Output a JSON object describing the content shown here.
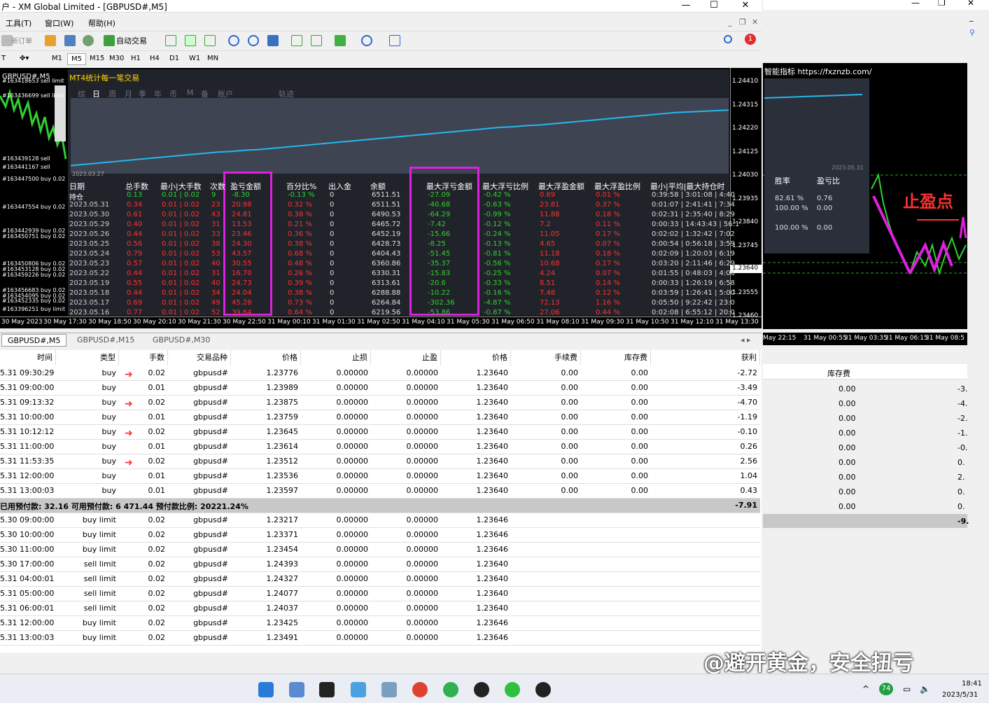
{
  "window": {
    "title": "户 - XM Global Limited - [GBPUSD#,M5]"
  },
  "menu": [
    "工具(T)",
    "窗口(W)",
    "帮助(H)"
  ],
  "toolbar": {
    "new_order": "新订单",
    "auto_trade": "自动交易",
    "notif_count": "1"
  },
  "timeframes": [
    "M1",
    "M5",
    "M15",
    "M30",
    "H1",
    "H4",
    "D1",
    "W1",
    "MN"
  ],
  "chart": {
    "title": "GBPUSD#,M5",
    "label_boxes": [
      "综",
      "日",
      "周",
      "月",
      "季",
      "年",
      "币",
      "M",
      "备",
      "账户",
      "轨迹"
    ],
    "panel_title": "MT4统计每一笔交易",
    "mini_start": "2023.03.27",
    "order_labels": [
      "#163418653 sell limit",
      "#163436699 sell limit",
      "#163439128 sell",
      "#163441167 sell",
      "#163447500 buy 0.02",
      "#163447554 buy 0.02",
      "#163442939 buy 0.02",
      "#163450751 buy 0.02",
      "#163450806 buy 0.02",
      "#163453128 buy 0.02",
      "#163459226 buy 0.02",
      "#163456683 buy 0.02",
      "#163454095 buy 0.02",
      "#163452335 buy 0.02",
      "#163396251 buy limit"
    ],
    "prices": [
      "1.24410",
      "1.24315",
      "1.24220",
      "1.24125",
      "1.24030",
      "1.23935",
      "1.23840",
      "1.23745",
      "1.23640",
      "1.23555",
      "1.23460"
    ],
    "times": [
      "30 May 2023",
      "30 May 17:30",
      "30 May 18:50",
      "30 May 20:10",
      "30 May 21:30",
      "30 May 22:50",
      "31 May 00:10",
      "31 May 01:30",
      "31 May 02:50",
      "31 May 04:10",
      "31 May 05:30",
      "31 May 06:50",
      "31 May 08:10",
      "31 May 09:30",
      "31 May 10:50",
      "31 May 12:10",
      "31 May 13:30"
    ],
    "equity_curve": [
      0.04,
      0.06,
      0.08,
      0.1,
      0.12,
      0.14,
      0.16,
      0.18,
      0.2,
      0.22,
      0.24,
      0.26,
      0.27,
      0.29,
      0.3,
      0.32,
      0.34,
      0.36,
      0.38,
      0.4,
      0.42,
      0.44,
      0.46,
      0.48,
      0.5,
      0.52,
      0.54,
      0.56,
      0.58,
      0.6,
      0.62,
      0.64,
      0.66,
      0.67,
      0.69,
      0.7,
      0.72,
      0.74,
      0.76,
      0.78,
      0.8,
      0.82,
      0.84,
      0.86,
      0.88,
      0.9,
      0.91,
      0.92,
      0.93,
      0.94
    ]
  },
  "stats": {
    "headers": [
      "日期",
      "总手数",
      "最小|大手数",
      "次数",
      "盈亏金额",
      "百分比%",
      "出入金",
      "余额",
      "最大浮亏金额",
      "最大浮亏比例",
      "最大浮盈金额",
      "最大浮盈比例",
      "最小|平均|最大持仓时"
    ],
    "rows": [
      [
        "持仓",
        "0.13",
        "0.01 | 0.02",
        "9",
        "-8.30",
        "-0.13 %",
        "0",
        "6511.51",
        "-27.09",
        "-0.42 %",
        "0.69",
        "0.01 %",
        "0:39:58 | 3:01:08 | 4:40"
      ],
      [
        "2023.05.31",
        "0.34",
        "0.01 | 0.02",
        "23",
        "20.98",
        "0.32 %",
        "0",
        "6511.51",
        "-40.68",
        "-0.63 %",
        "23.81",
        "0.37 %",
        "0:01:07 | 2:41:41 | 7:34"
      ],
      [
        "2023.05.30",
        "0.61",
        "0.01 | 0.02",
        "43",
        "24.81",
        "0.38 %",
        "0",
        "6490.53",
        "-64.29",
        "-0.99 %",
        "11.88",
        "0.18 %",
        "0:02:31 | 2:35:40 | 8:29"
      ],
      [
        "2023.05.29",
        "0.40",
        "0.01 | 0.02",
        "31",
        "13.53",
        "0.21 %",
        "0",
        "6465.72",
        "-7.42",
        "-0.12 %",
        "7.2",
        "0.11 %",
        "0:00:33 | 14:43:43 | 56:1"
      ],
      [
        "2023.05.26",
        "0.44",
        "0.01 | 0.02",
        "33",
        "23.46",
        "0.36 %",
        "0",
        "6452.19",
        "-15.66",
        "-0.24 %",
        "11.05",
        "0.17 %",
        "0:02:02 | 1:32:42 | 7:02"
      ],
      [
        "2023.05.25",
        "0.56",
        "0.01 | 0.02",
        "38",
        "24.30",
        "0.38 %",
        "0",
        "6428.73",
        "-8.25",
        "-0.13 %",
        "4.65",
        "0.07 %",
        "0:00:54 | 0:56:18 | 3:59"
      ],
      [
        "2023.05.24",
        "0.79",
        "0.01 | 0.02",
        "53",
        "43.57",
        "0.68 %",
        "0",
        "6404.43",
        "-51.45",
        "-0.81 %",
        "11.18",
        "0.18 %",
        "0:02:09 | 1:20:03 | 6:19"
      ],
      [
        "2023.05.23",
        "0.57",
        "0.01 | 0.02",
        "40",
        "30.55",
        "0.48 %",
        "0",
        "6360.86",
        "-35.37",
        "-0.56 %",
        "10.68",
        "0.17 %",
        "0:03:20 | 2:11:46 | 6:29"
      ],
      [
        "2023.05.22",
        "0.44",
        "0.01 | 0.02",
        "31",
        "16.70",
        "0.26 %",
        "0",
        "6330.31",
        "-15.83",
        "-0.25 %",
        "4.24",
        "0.07 %",
        "0:01:55 | 0:48:03 | 4:06"
      ],
      [
        "2023.05.19",
        "0.55",
        "0.01 | 0.02",
        "40",
        "24.73",
        "0.39 %",
        "0",
        "6313.61",
        "-20.6",
        "-0.33 %",
        "8.51",
        "0.14 %",
        "0:00:33 | 1:26:19 | 6:58"
      ],
      [
        "2023.05.18",
        "0.44",
        "0.01 | 0.02",
        "34",
        "24.04",
        "0.38 %",
        "0",
        "6288.88",
        "-10.22",
        "-0.16 %",
        "7.48",
        "0.12 %",
        "0:03:59 | 1:26:41 | 5:00"
      ],
      [
        "2023.05.17",
        "0.69",
        "0.01 | 0.02",
        "49",
        "45.28",
        "0.73 %",
        "0",
        "6264.84",
        "-302.36",
        "-4.87 %",
        "72.13",
        "1.16 %",
        "0:05:50 | 9:22:42 | 23:0"
      ],
      [
        "2023.05.16",
        "0.77",
        "0.01 | 0.02",
        "52",
        "39.64",
        "0.64 %",
        "0",
        "6219.56",
        "-53.86",
        "-0.87 %",
        "27.06",
        "0.44 %",
        "0:02:08 | 6:55:12 | 20:0"
      ]
    ]
  },
  "tabs": [
    "GBPUSD#,M5",
    "GBPUSD#,M15",
    "GBPUSD#,M30"
  ],
  "grid": {
    "headers": [
      "时间",
      "类型",
      "手数",
      "交易品种",
      "价格",
      "止损",
      "止盈",
      "价格",
      "手续费",
      "库存费",
      "获利"
    ],
    "orders": [
      [
        "5.31 09:30:29",
        "buy",
        "0.02",
        "gbpusd#",
        "1.23776",
        "0.00000",
        "0.00000",
        "1.23640",
        "0.00",
        "0.00",
        "-2.72"
      ],
      [
        "5.31 09:00:00",
        "buy",
        "0.01",
        "gbpusd#",
        "1.23989",
        "0.00000",
        "0.00000",
        "1.23640",
        "0.00",
        "0.00",
        "-3.49"
      ],
      [
        "5.31 09:13:32",
        "buy",
        "0.02",
        "gbpusd#",
        "1.23875",
        "0.00000",
        "0.00000",
        "1.23640",
        "0.00",
        "0.00",
        "-4.70"
      ],
      [
        "5.31 10:00:00",
        "buy",
        "0.01",
        "gbpusd#",
        "1.23759",
        "0.00000",
        "0.00000",
        "1.23640",
        "0.00",
        "0.00",
        "-1.19"
      ],
      [
        "5.31 10:12:12",
        "buy",
        "0.02",
        "gbpusd#",
        "1.23645",
        "0.00000",
        "0.00000",
        "1.23640",
        "0.00",
        "0.00",
        "-0.10"
      ],
      [
        "5.31 11:00:00",
        "buy",
        "0.01",
        "gbpusd#",
        "1.23614",
        "0.00000",
        "0.00000",
        "1.23640",
        "0.00",
        "0.00",
        "0.26"
      ],
      [
        "5.31 11:53:35",
        "buy",
        "0.02",
        "gbpusd#",
        "1.23512",
        "0.00000",
        "0.00000",
        "1.23640",
        "0.00",
        "0.00",
        "2.56"
      ],
      [
        "5.31 12:00:00",
        "buy",
        "0.01",
        "gbpusd#",
        "1.23536",
        "0.00000",
        "0.00000",
        "1.23640",
        "0.00",
        "0.00",
        "1.04"
      ],
      [
        "5.31 13:00:03",
        "buy",
        "0.01",
        "gbpusd#",
        "1.23597",
        "0.00000",
        "0.00000",
        "1.23640",
        "0.00",
        "0.00",
        "0.43"
      ]
    ],
    "summary": "已用预付款: 32.16  可用预付款: 6 471.44  预付款比例: 20221.24%",
    "summary_profit": "-7.91",
    "pending": [
      [
        "5.30 09:00:00",
        "buy limit",
        "0.02",
        "gbpusd#",
        "1.23217",
        "0.00000",
        "0.00000",
        "1.23646"
      ],
      [
        "5.30 10:00:00",
        "buy limit",
        "0.02",
        "gbpusd#",
        "1.23371",
        "0.00000",
        "0.00000",
        "1.23646"
      ],
      [
        "5.30 11:00:00",
        "buy limit",
        "0.02",
        "gbpusd#",
        "1.23454",
        "0.00000",
        "0.00000",
        "1.23646"
      ],
      [
        "5.30 17:00:00",
        "sell limit",
        "0.02",
        "gbpusd#",
        "1.24393",
        "0.00000",
        "0.00000",
        "1.23640"
      ],
      [
        "5.31 04:00:01",
        "sell limit",
        "0.02",
        "gbpusd#",
        "1.24327",
        "0.00000",
        "0.00000",
        "1.23640"
      ],
      [
        "5.31 05:00:00",
        "sell limit",
        "0.02",
        "gbpusd#",
        "1.24077",
        "0.00000",
        "0.00000",
        "1.23640"
      ],
      [
        "5.31 06:00:01",
        "sell limit",
        "0.02",
        "gbpusd#",
        "1.24037",
        "0.00000",
        "0.00000",
        "1.23640"
      ],
      [
        "5.31 12:00:00",
        "buy limit",
        "0.02",
        "gbpusd#",
        "1.23425",
        "0.00000",
        "0.00000",
        "1.23646"
      ],
      [
        "5.31 13:00:03",
        "buy limit",
        "0.02",
        "gbpusd#",
        "1.23491",
        "0.00000",
        "0.00000",
        "1.23646"
      ]
    ]
  },
  "right": {
    "indicator": "智能指标 https://fxznzb.com/",
    "date": "2023.05.31",
    "winrate_label": "胜率",
    "pnl_ratio_label": "盈亏比",
    "w1": "82.61 %",
    "p1": "0.76",
    "w2": "100.00 %",
    "p2": "0.00",
    "w3": "100.00 %",
    "p3": "0.00",
    "tp_label": "止盈点",
    "times": [
      "May 22:15",
      "31 May 00:55",
      "31 May 03:35",
      "31 May 06:15",
      "31 May 08:5"
    ],
    "col_header": "库存费",
    "col_vals": [
      "0.00",
      "0.00",
      "0.00",
      "0.00",
      "0.00",
      "0.00",
      "0.00",
      "0.00",
      "0.00"
    ],
    "profit_vals": [
      "-3.",
      "-4.",
      "-2.",
      "-1.",
      "-0.",
      "0.",
      "2.",
      "0.",
      "0."
    ],
    "summary_val": "-9."
  },
  "taskbar": {
    "clock": "18:41",
    "date": "2023/5/31",
    "badge": "74"
  },
  "watermark": "@避开黄金，安全扭亏",
  "colors": {
    "red": "#ff3030",
    "green": "#30d030",
    "curve": "#25b8f0",
    "magenta": "#e020e0"
  }
}
